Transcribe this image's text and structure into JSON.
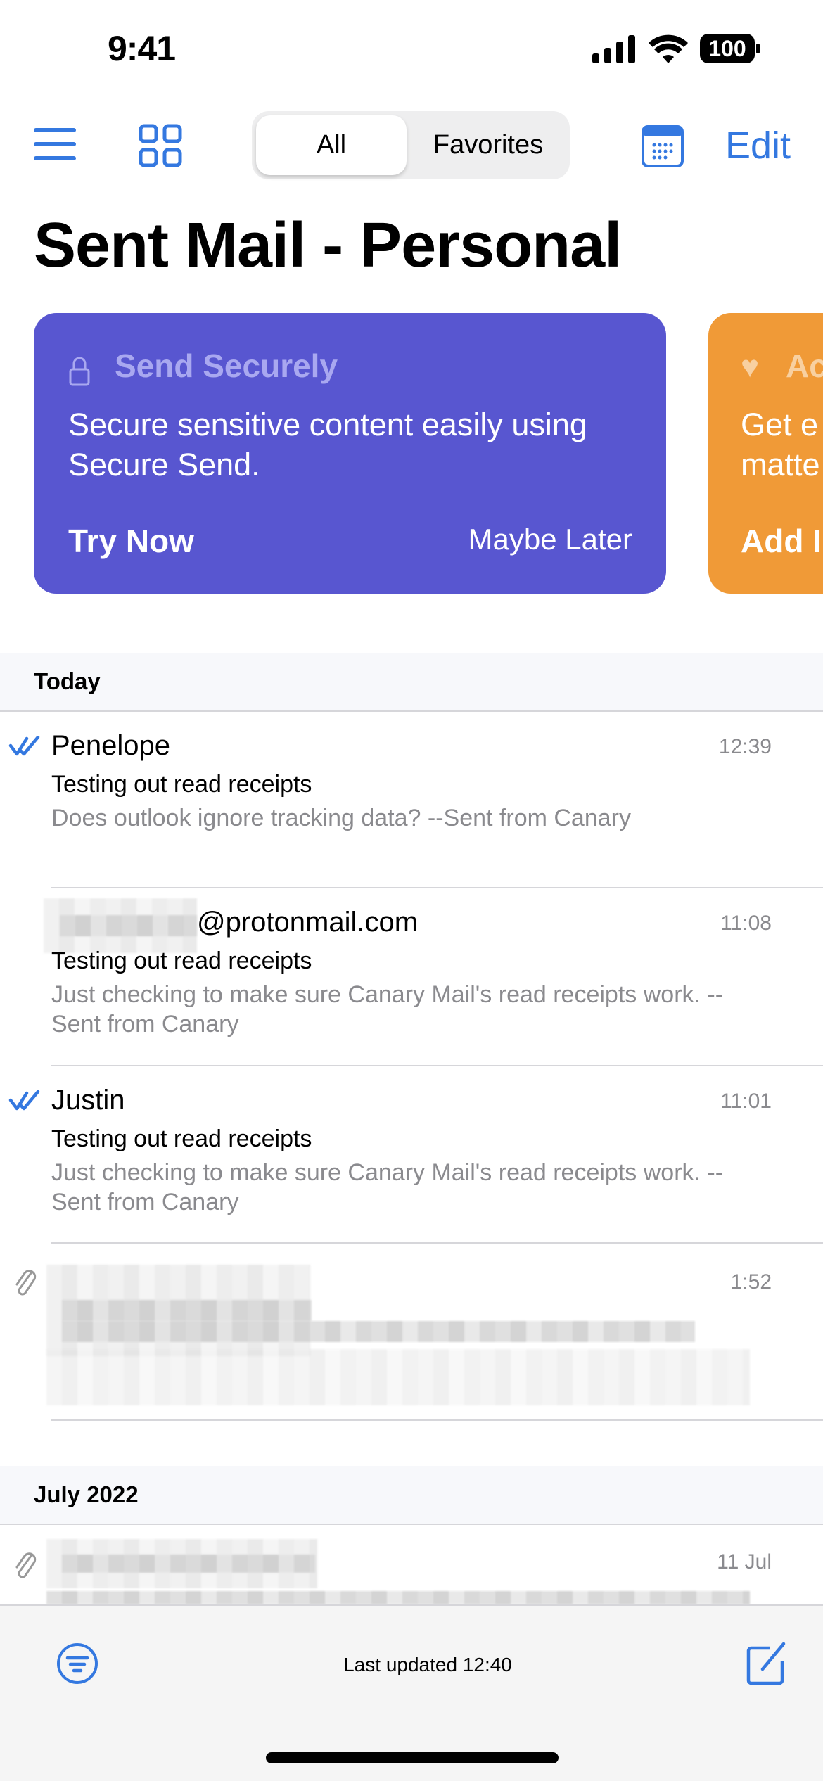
{
  "status_bar": {
    "time": "9:41",
    "battery": "100"
  },
  "toolbar": {
    "segments": [
      "All",
      "Favorites"
    ],
    "selected": "All",
    "edit_label": "Edit"
  },
  "page_title": "Sent Mail - Personal",
  "cards": [
    {
      "title": "Send Securely",
      "body_lines": [
        "Secure sensitive content easily using",
        "Secure Send."
      ],
      "primary": "Try Now",
      "secondary": "Maybe Later",
      "color": "#5856D0",
      "icon": "lock-icon"
    },
    {
      "title": "Ac",
      "body_lines": [
        "Get e",
        "matte"
      ],
      "primary": "Add I",
      "color": "#F09A37",
      "icon": "heart-icon"
    }
  ],
  "sections": [
    {
      "label": "Today",
      "rows": [
        {
          "sender": "Penelope",
          "time": "12:39",
          "subject": "Testing out read receipts",
          "preview": "Does outlook ignore tracking data? --Sent from Canary",
          "read_receipt": true
        },
        {
          "sender": "@protonmail.com",
          "time": "11:08",
          "subject": "Testing out read receipts",
          "preview": "Just checking to make sure Canary Mail's read receipts work. --Sent from Canary",
          "read_receipt": false
        },
        {
          "sender": "Justin",
          "time": "11:01",
          "subject": "Testing out read receipts",
          "preview": "Just checking to make sure Canary Mail's read receipts work. --Sent from Canary",
          "read_receipt": true
        },
        {
          "time": "1:52",
          "attachment": true
        }
      ]
    },
    {
      "label": "July 2022",
      "rows": [
        {
          "time": "11 Jul",
          "attachment": true
        }
      ]
    }
  ],
  "bottom_bar": {
    "status": "Last updated 12:40"
  },
  "colors": {
    "accent": "#3478E0",
    "secondary_text": "#8A8A8E"
  }
}
